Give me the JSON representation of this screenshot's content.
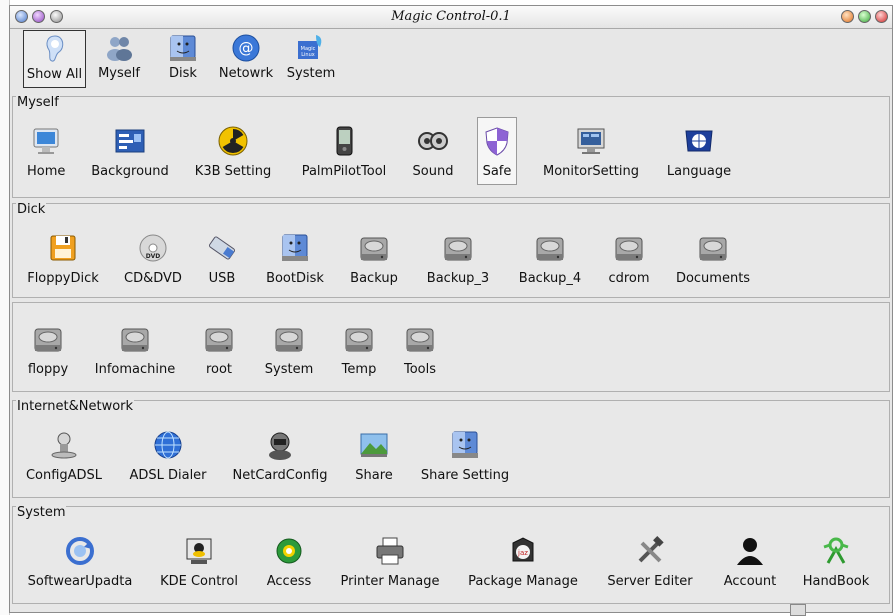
{
  "window": {
    "title": "Magic Control-0.1"
  },
  "toolbar": [
    {
      "label": "Show All",
      "icon": "show-all-icon",
      "active": true
    },
    {
      "label": "Myself",
      "icon": "users-icon"
    },
    {
      "label": "Disk",
      "icon": "finder-disk-icon"
    },
    {
      "label": "Netowrk",
      "icon": "at-sign-icon"
    },
    {
      "label": "System",
      "icon": "magic-linux-icon"
    }
  ],
  "sections": [
    {
      "title": "Myself",
      "items": [
        {
          "label": "Home",
          "icon": "monitor-icon"
        },
        {
          "label": "Background",
          "icon": "background-icon"
        },
        {
          "label": "K3B Setting",
          "icon": "radiation-icon"
        },
        {
          "label": "PalmPilotTool",
          "icon": "pda-icon"
        },
        {
          "label": "Sound",
          "icon": "speaker-icon"
        },
        {
          "label": "Safe",
          "icon": "shield-icon",
          "selected": true
        },
        {
          "label": "MonitorSetting",
          "icon": "display-settings-icon"
        },
        {
          "label": "Language",
          "icon": "globe-flag-icon"
        }
      ]
    },
    {
      "title": "Dick",
      "items": [
        {
          "label": "FloppyDick",
          "icon": "floppy-icon"
        },
        {
          "label": "CD&DVD",
          "icon": "dvd-icon"
        },
        {
          "label": "USB",
          "icon": "usb-icon"
        },
        {
          "label": "BootDisk",
          "icon": "finder-disk-icon"
        },
        {
          "label": "Backup",
          "icon": "hard-drive-icon"
        },
        {
          "label": "Backup_3",
          "icon": "hard-drive-icon"
        },
        {
          "label": "Backup_4",
          "icon": "hard-drive-icon"
        },
        {
          "label": "cdrom",
          "icon": "hard-drive-icon"
        },
        {
          "label": "Documents",
          "icon": "hard-drive-icon"
        }
      ]
    },
    {
      "title": "",
      "items": [
        {
          "label": "floppy",
          "icon": "hard-drive-icon"
        },
        {
          "label": "Infomachine",
          "icon": "hard-drive-icon"
        },
        {
          "label": "root",
          "icon": "hard-drive-icon"
        },
        {
          "label": "System",
          "icon": "hard-drive-icon"
        },
        {
          "label": "Temp",
          "icon": "hard-drive-icon"
        },
        {
          "label": "Tools",
          "icon": "hard-drive-icon"
        }
      ]
    },
    {
      "title": "Internet&Network",
      "items": [
        {
          "label": "ConfigADSL",
          "icon": "network-node-icon"
        },
        {
          "label": "ADSL Dialer",
          "icon": "network-globe-icon"
        },
        {
          "label": "NetCardConfig",
          "icon": "astronaut-icon"
        },
        {
          "label": "Share",
          "icon": "share-icon"
        },
        {
          "label": "Share Setting",
          "icon": "finder-icon"
        }
      ]
    },
    {
      "title": "System",
      "items": [
        {
          "label": "SoftwearUpadta",
          "icon": "update-icon"
        },
        {
          "label": "KDE Control",
          "icon": "kde-control-icon"
        },
        {
          "label": "Access",
          "icon": "green-orb-icon"
        },
        {
          "label": "Printer Manage",
          "icon": "printer-icon"
        },
        {
          "label": "Package Manage",
          "icon": "package-icon"
        },
        {
          "label": "Server Editer",
          "icon": "tools-icon"
        },
        {
          "label": "Account",
          "icon": "user-silhouette-icon"
        },
        {
          "label": "HandBook",
          "icon": "handbook-icon"
        }
      ]
    }
  ],
  "colors": {
    "window_bg": "#e7e7e7",
    "section_border": "#b0b0b0",
    "accent_blue": "#3b6fd0"
  }
}
